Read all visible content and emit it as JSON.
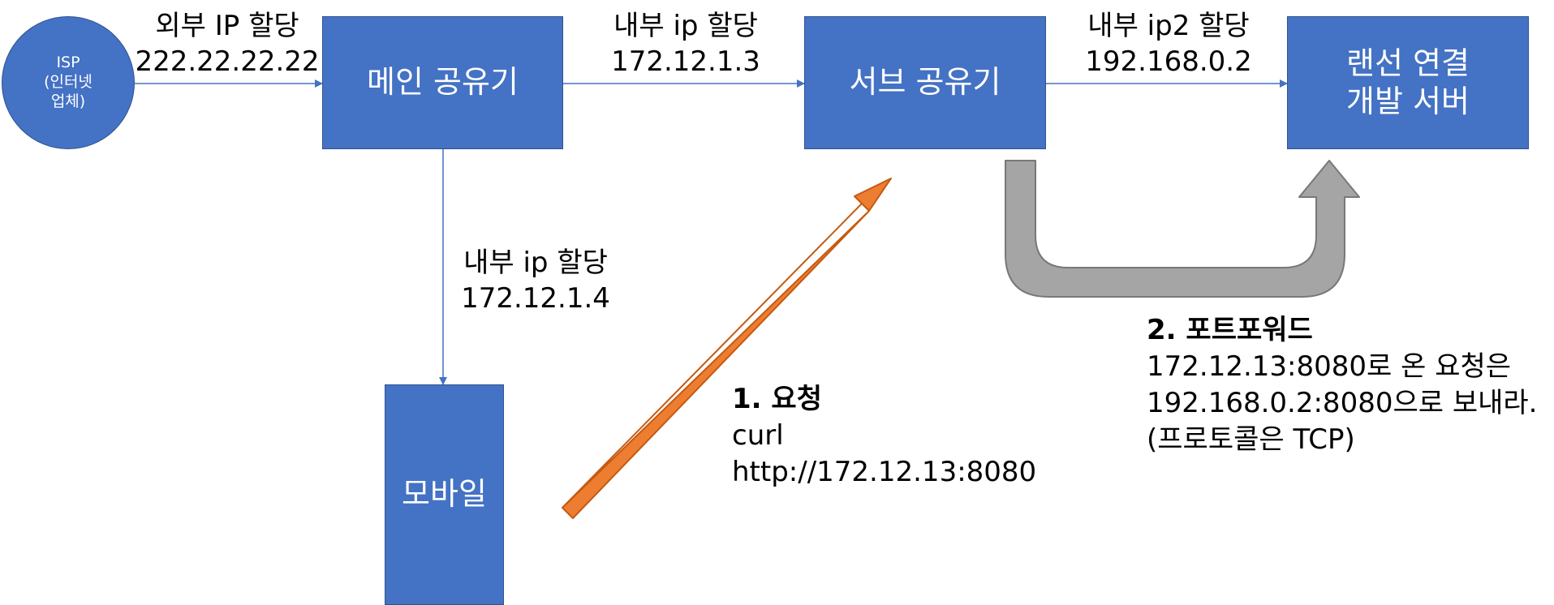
{
  "nodes": {
    "isp": {
      "lines": [
        "ISP",
        "(인터넷",
        "업체)"
      ]
    },
    "main_router": {
      "lines": [
        "메인 공유기"
      ]
    },
    "sub_router": {
      "lines": [
        "서브 공유기"
      ]
    },
    "dev_server": {
      "lines": [
        "랜선 연결",
        "개발 서버"
      ]
    },
    "mobile": {
      "lines": [
        "모바일"
      ]
    }
  },
  "edges": {
    "isp_to_main": {
      "line1": "외부 IP 할당",
      "line2": "222.22.22.22"
    },
    "main_to_sub": {
      "line1": "내부 ip 할당",
      "line2": "172.12.1.3"
    },
    "sub_to_server": {
      "line1": "내부 ip2 할당",
      "line2": "192.168.0.2"
    },
    "main_to_mobile": {
      "line1": "내부 ip 할당",
      "line2": "172.12.1.4"
    }
  },
  "request_note": {
    "title": "1. 요청",
    "lines": [
      "curl",
      "http://172.12.13:8080"
    ]
  },
  "forward_note": {
    "title": "2. 포트포워드",
    "lines": [
      "172.12.13:8080로 온 요청은",
      "192.168.0.2:8080으로 보내라.",
      "(프로토콜은 TCP)"
    ]
  },
  "colors": {
    "node_fill": "#4472c4",
    "connector": "#4472c4",
    "request_arrow": "#ed7d31",
    "forward_arrow": "#a5a5a5"
  }
}
